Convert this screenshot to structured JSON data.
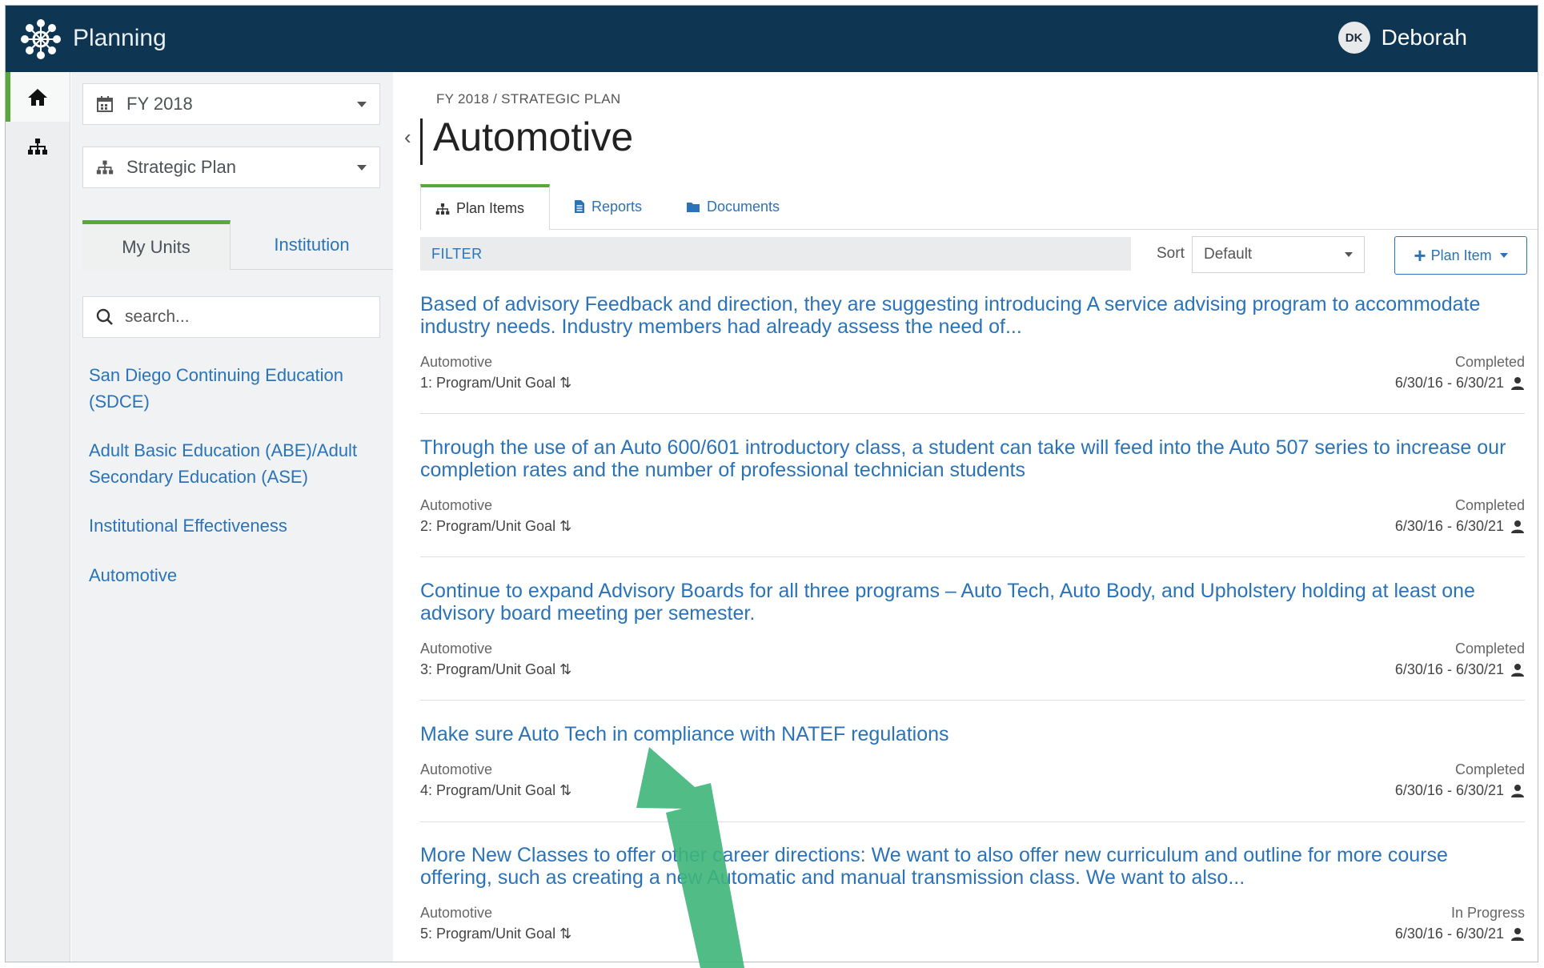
{
  "header": {
    "app_title": "Planning",
    "user_initials": "DK",
    "user_name": "Deborah",
    "bar_color": "#0e3552"
  },
  "rail": {
    "items": [
      {
        "icon": "home-icon",
        "active": true
      },
      {
        "icon": "org-chart-icon",
        "active": false
      }
    ]
  },
  "sidebar": {
    "fiscal_year": "FY 2018",
    "plan": "Strategic Plan",
    "tabs": [
      "My Units",
      "Institution"
    ],
    "search_placeholder": "search...",
    "units": [
      "San Diego Continuing Education (SDCE)",
      "Adult Basic Education (ABE)/Adult Secondary Education (ASE)",
      "Institutional Effectiveness",
      "Automotive"
    ]
  },
  "main": {
    "breadcrumb": "FY 2018 / STRATEGIC PLAN",
    "title": "Automotive",
    "tabs": [
      {
        "label": "Plan Items",
        "icon": "org-chart-icon"
      },
      {
        "label": "Reports",
        "icon": "document-icon"
      },
      {
        "label": "Documents",
        "icon": "folder-icon"
      }
    ],
    "filter_label": "FILTER",
    "sort_label": "Sort",
    "sort_value": "Default",
    "add_button": "Plan Item",
    "items": [
      {
        "text": "Based of advisory Feedback and direction, they are suggesting introducing A service advising program to accommodate industry needs. Industry members had already assess the need of...",
        "unit": "Automotive",
        "goal": "1: Program/Unit Goal",
        "status": "Completed",
        "dates": "6/30/16 - 6/30/21"
      },
      {
        "text": "Through the use of an Auto 600/601 introductory class, a student can take will feed into the Auto 507 series to increase our completion rates and the number of professional technician students",
        "unit": "Automotive",
        "goal": "2: Program/Unit Goal",
        "status": "Completed",
        "dates": "6/30/16 - 6/30/21"
      },
      {
        "text": "Continue to expand Advisory Boards for all three programs – Auto Tech, Auto Body, and Upholstery holding at least one advisory board meeting per semester.",
        "unit": "Automotive",
        "goal": "3: Program/Unit Goal",
        "status": "Completed",
        "dates": "6/30/16 - 6/30/21"
      },
      {
        "text": "Make sure Auto Tech in compliance with NATEF regulations",
        "unit": "Automotive",
        "goal": "4: Program/Unit Goal",
        "status": "Completed",
        "dates": "6/30/16 - 6/30/21"
      },
      {
        "text": "More New Classes to offer other career directions: We want to also offer new curriculum and outline for more course offering, such as creating a new Automatic and manual transmission class. We want to also...",
        "unit": "Automotive",
        "goal": "5: Program/Unit Goal",
        "status": "In Progress",
        "dates": "6/30/16 - 6/30/21"
      }
    ]
  },
  "colors": {
    "accent_green": "#5aa83a",
    "link_blue": "#2b73b8",
    "annotation_arrow": "#3fb57a"
  }
}
